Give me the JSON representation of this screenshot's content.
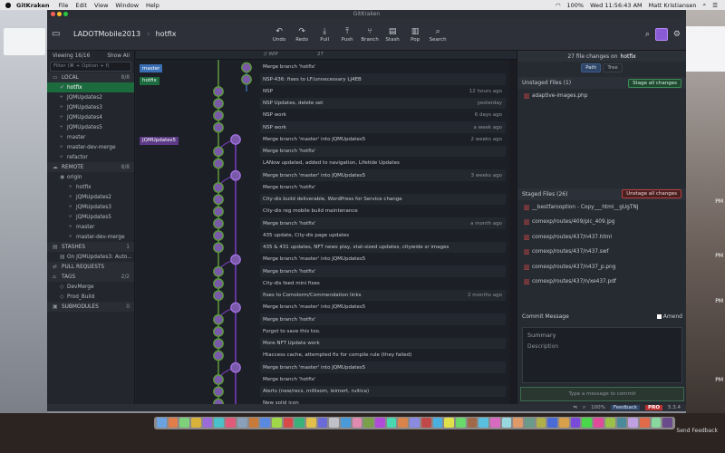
{
  "menubar": {
    "apple": "",
    "items": [
      "GitKraken",
      "File",
      "Edit",
      "View",
      "Window",
      "Help"
    ],
    "battery": "100%",
    "clock": "Wed 11:56:43 AM",
    "user": "Matt Kristiansen"
  },
  "window": {
    "title": "GitKraken",
    "repo": "LADOTMobile2013",
    "branch": "hotfix"
  },
  "toolbar": {
    "buttons": [
      {
        "icon": "undo-icon",
        "glyph": "↶",
        "label": "Undo"
      },
      {
        "icon": "redo-icon",
        "glyph": "↷",
        "label": "Redo"
      },
      {
        "icon": "pull-icon",
        "glyph": "⤓",
        "label": "Pull"
      },
      {
        "icon": "push-icon",
        "glyph": "⤒",
        "label": "Push"
      },
      {
        "icon": "branch-icon",
        "glyph": "⑂",
        "label": "Branch"
      },
      {
        "icon": "stash-icon",
        "glyph": "▤",
        "label": "Stash"
      },
      {
        "icon": "pop-icon",
        "glyph": "▥",
        "label": "Pop"
      },
      {
        "icon": "search-icon",
        "glyph": "⌕",
        "label": "Search"
      }
    ]
  },
  "left_panel": {
    "viewing": "Viewing 16/16",
    "show_all": "Show All",
    "filter_placeholder": "Filter (⌘ + Option + f)",
    "local": {
      "label": "LOCAL",
      "count": "8/8",
      "items": [
        "hotfix",
        "JQMUpdates2",
        "JQMUpdates3",
        "JQMUpdates4",
        "JQMUpdates5",
        "master",
        "master-dev-merge",
        "refactor"
      ]
    },
    "remote": {
      "label": "REMOTE",
      "count": "8/8",
      "origin": "origin",
      "items": [
        "hotfix",
        "JQMUpdates2",
        "JQMUpdates3",
        "JQMUpdates5",
        "master",
        "master-dev-merge"
      ]
    },
    "stashes": {
      "label": "STASHES",
      "count": "1",
      "items": [
        "On JQMUpdates3: Auto..."
      ]
    },
    "pull_requests": {
      "label": "PULL REQUESTS",
      "count": ""
    },
    "tags": {
      "label": "TAGS",
      "count": "2/2",
      "items": [
        "DevMerge",
        "Prod_Build"
      ]
    },
    "submodules": {
      "label": "SUBMODULES",
      "count": "0"
    }
  },
  "graph": {
    "head_wip": "// WIP",
    "head_count": "27",
    "labels": [
      {
        "text": "master",
        "color": "#3a6fb4",
        "row": 1
      },
      {
        "text": "hotfix",
        "color": "#1c6b3f",
        "row": 2
      },
      {
        "text": "JQMUpdates5",
        "color": "#5c3a86",
        "row": 7
      }
    ],
    "commits": [
      {
        "msg": "Merge branch 'hotfix'",
        "time": ""
      },
      {
        "msg": "NSP-436: fixes to LF/unnecessary LJ4EB",
        "time": ""
      },
      {
        "msg": "NSP",
        "time": "12 hours ago"
      },
      {
        "msg": "NSP Updates, delete set",
        "time": "yesterday"
      },
      {
        "msg": "NSP work",
        "time": "6 days ago"
      },
      {
        "msg": "NSP work",
        "time": "a week ago"
      },
      {
        "msg": "Merge branch 'master' into JQMUpdates5",
        "time": "2 weeks ago"
      },
      {
        "msg": "Merge branch 'hotfix'",
        "time": ""
      },
      {
        "msg": "LANow updated, added to navigation, Lifetide Updates",
        "time": ""
      },
      {
        "msg": "Merge branch 'master' into JQMUpdates5",
        "time": "3 weeks ago"
      },
      {
        "msg": "Merge branch 'hotfix'",
        "time": ""
      },
      {
        "msg": "City-dis build deliverable, WordPress for Service change",
        "time": ""
      },
      {
        "msg": "City-dis reg mobile build maintenance",
        "time": ""
      },
      {
        "msg": "Merge branch 'hotfix'",
        "time": "a month ago"
      },
      {
        "msg": "435 update, City-dis page updates",
        "time": ""
      },
      {
        "msg": "435 & 431 updates, NFT news play, stat-sized updates, citywide sr images",
        "time": ""
      },
      {
        "msg": "Merge branch 'master' into JQMUpdates5",
        "time": ""
      },
      {
        "msg": "Merge branch 'hotfix'",
        "time": ""
      },
      {
        "msg": "City-dis feed mini fixes",
        "time": ""
      },
      {
        "msg": "fixes to Comolorm/Commendation links",
        "time": "2 months ago"
      },
      {
        "msg": "Merge branch 'master' into JQMUpdates5",
        "time": ""
      },
      {
        "msg": "Merge branch 'hotfix'",
        "time": ""
      },
      {
        "msg": "Forgot to save this too.",
        "time": ""
      },
      {
        "msg": "More NFT Update work",
        "time": ""
      },
      {
        "msg": "Htaccess cache, attempted fix for compile rule (they failed)",
        "time": ""
      },
      {
        "msg": "Merge branch 'master' into JQMUpdates5",
        "time": ""
      },
      {
        "msg": "Merge branch 'hotfix'",
        "time": ""
      },
      {
        "msg": "Alerts (new/recs, millisom, leimert, ruitica)",
        "time": ""
      },
      {
        "msg": "New solid icon",
        "time": ""
      }
    ]
  },
  "right_panel": {
    "summary": "27 file changes on",
    "summary_branch": "hotfix",
    "path_tab": "Path",
    "tree_tab": "Tree",
    "unstaged_label": "Unstaged Files (1)",
    "stage_all": "Stage all changes",
    "unstaged_files": [
      "adaptive-images.php"
    ],
    "staged_label": "Staged Files (26)",
    "unstage_all": "Unstage all changes",
    "staged_files": [
      "__bestfarooption - Copy___html__gUgTNJ",
      "comexp/routes/409/plc_409.jpg",
      "comexp/routes/437/n437.html",
      "comexp/routes/437/n437.swf",
      "comexp/routes/437/n437_p.png",
      "comexp/routes/437/n/xe437.pdf"
    ],
    "commit_message": "Commit Message",
    "amend": "Amend",
    "summary_placeholder": "Summary",
    "description_placeholder": "Description",
    "commit_button": "Type a message to commit"
  },
  "statusbar": {
    "zoom": "100%",
    "feedback": "Feedback",
    "pro": "PRO",
    "version": "5.3.4"
  },
  "desktop": {
    "send_feedback": "Send Feedback",
    "right_labels": [
      "PM",
      "PM",
      "PM",
      "PM"
    ]
  }
}
